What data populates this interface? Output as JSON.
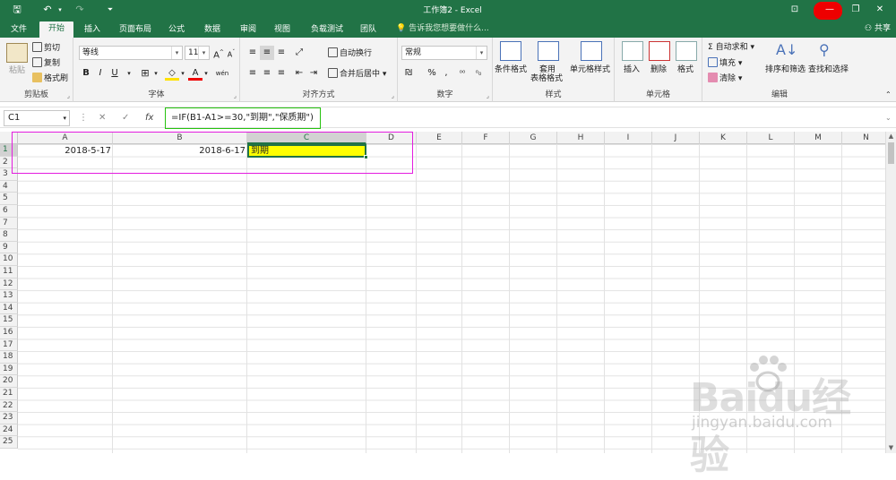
{
  "window": {
    "title": "工作簿2 - Excel"
  },
  "tabs": {
    "items": [
      "文件",
      "开始",
      "插入",
      "页面布局",
      "公式",
      "数据",
      "审阅",
      "视图",
      "负载测试",
      "团队"
    ],
    "active": "开始",
    "tell_me": "告诉我您想要做什么...",
    "share": "共享"
  },
  "ribbon": {
    "clipboard": {
      "label": "剪贴板",
      "paste": "粘贴",
      "cut": "剪切",
      "copy": "复制",
      "format_painter": "格式刷"
    },
    "font": {
      "label": "字体",
      "name": "等线",
      "size": "11",
      "grow": "A",
      "shrink": "A",
      "bold": "B",
      "italic": "I",
      "underline": "U",
      "wen": "wén"
    },
    "alignment": {
      "label": "对齐方式",
      "wrap": "自动换行",
      "merge": "合并后居中"
    },
    "number": {
      "label": "数字",
      "format": "常规",
      "percent": "%",
      "comma": ","
    },
    "styles": {
      "label": "样式",
      "conditional": "条件格式",
      "table": "套用\n表格格式",
      "table_l1": "套用",
      "table_l2": "表格格式",
      "cell_styles": "单元格样式"
    },
    "cells": {
      "label": "单元格",
      "insert": "插入",
      "delete": "删除",
      "format": "格式"
    },
    "editing": {
      "label": "编辑",
      "autosum": "自动求和",
      "fill": "填充",
      "clear": "清除",
      "sort": "排序和筛选",
      "find": "查找和选择"
    }
  },
  "formula_bar": {
    "name_box": "C1",
    "fx": "fx",
    "formula": "=IF(B1-A1>=30,\"到期\",\"保质期\")"
  },
  "sheet": {
    "columns": [
      "A",
      "B",
      "C",
      "D",
      "E",
      "F",
      "G",
      "H",
      "I",
      "J",
      "K",
      "L",
      "M",
      "N"
    ],
    "selected_column": "C",
    "selected_row": 1,
    "rows": [
      "1",
      "2",
      "3",
      "4",
      "5",
      "6",
      "7",
      "8",
      "9",
      "10",
      "11",
      "12",
      "13",
      "14",
      "15",
      "16",
      "17",
      "18",
      "19",
      "20",
      "21",
      "22",
      "23",
      "24",
      "25"
    ],
    "cells": {
      "A1": "2018-5-17",
      "B1": "2018-6-17",
      "C1": "到期"
    },
    "highlight_color": "#ffff00"
  },
  "watermark": {
    "logo_text": "Baidu经验",
    "url": "jingyan.baidu.com"
  },
  "colors": {
    "excel_green": "#217346",
    "formula_outline": "#26c20f",
    "annotation_outline": "#e31cdf"
  }
}
